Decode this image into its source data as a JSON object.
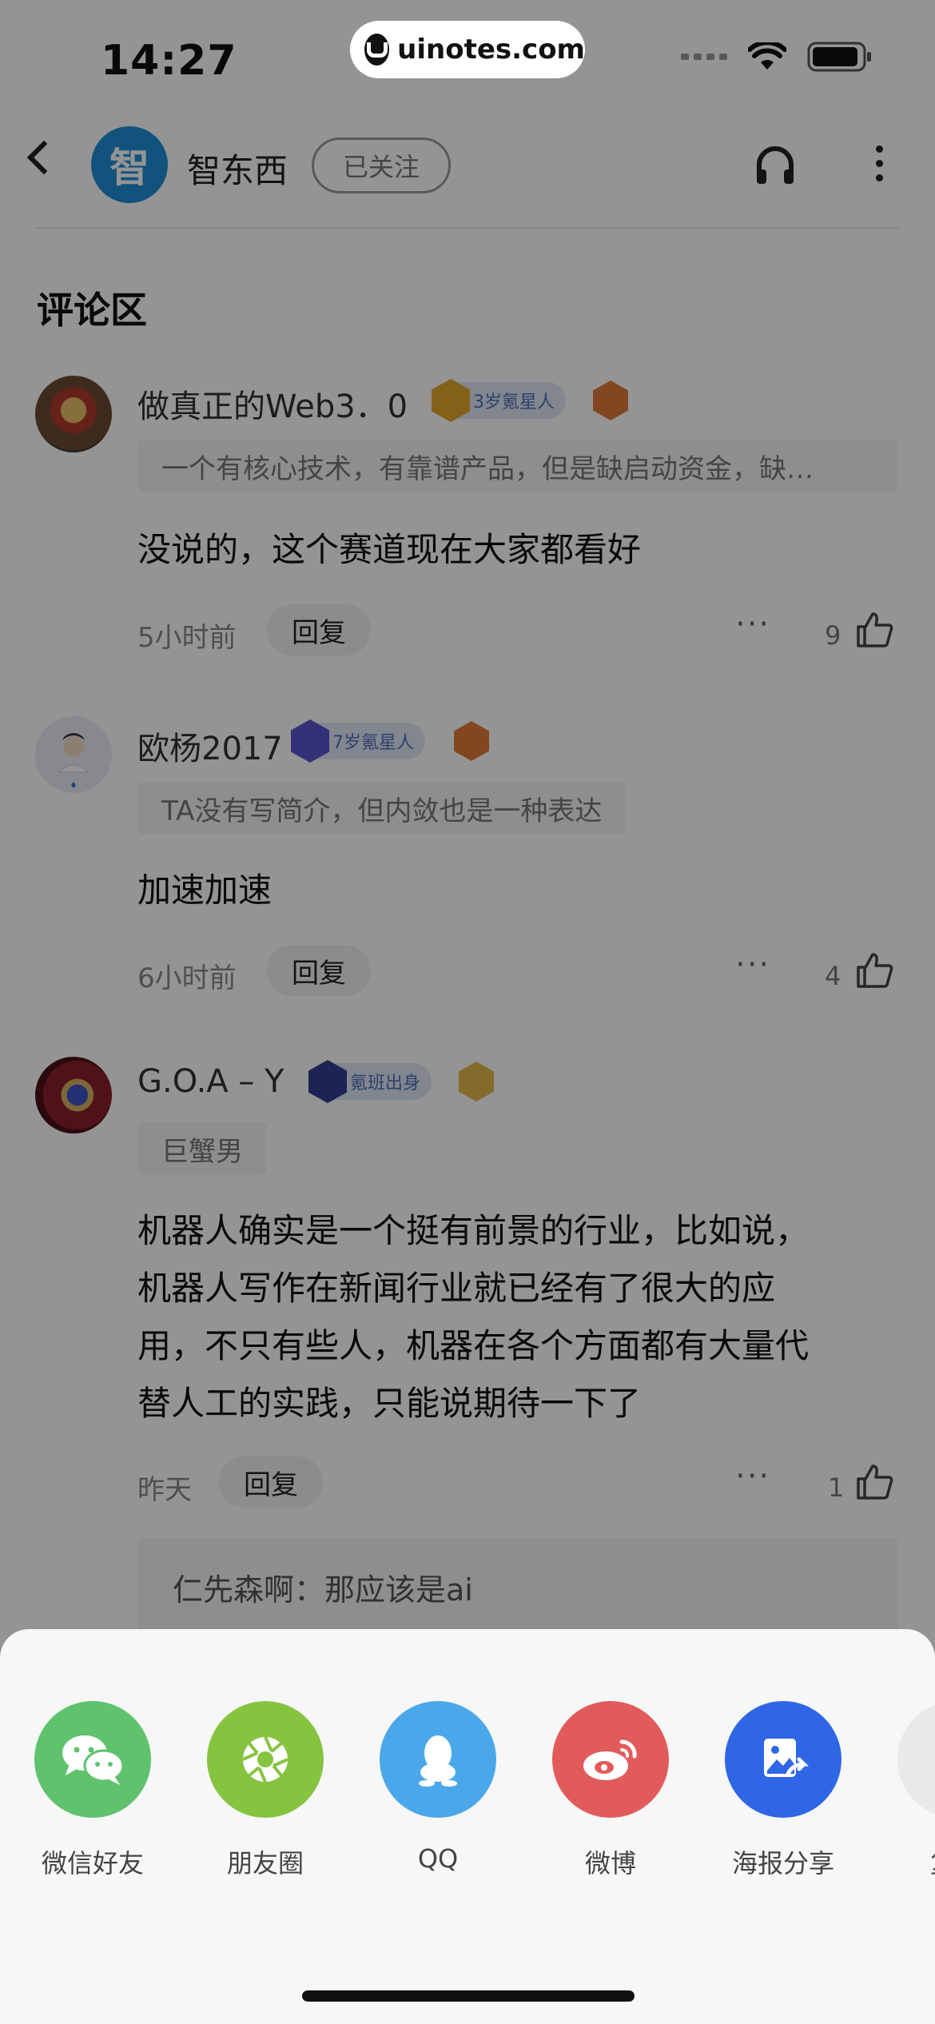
{
  "status_bar": {
    "time": "14:27",
    "watermark": "uinotes.com"
  },
  "header": {
    "account_name": "智东西",
    "follow_label": "已关注",
    "avatar_text": "智"
  },
  "section_title": "评论区",
  "comments": [
    {
      "user": "做真正的Web3．0",
      "badge": "3岁氪星人",
      "bio": "一个有核心技术，有靠谱产品，但是缺启动资金，缺…",
      "text": [
        "没说的，这个赛道现在大家都看好"
      ],
      "time": "5小时前",
      "reply_label": "回复",
      "likes": "9"
    },
    {
      "user": "欧杨2017",
      "badge": "7岁氪星人",
      "bio": "TA没有写简介，但内敛也是一种表达",
      "text": [
        "加速加速"
      ],
      "time": "6小时前",
      "reply_label": "回复",
      "likes": "4"
    },
    {
      "user": "G.O.A – Y",
      "badge": "氪班出身",
      "bio": "巨蟹男",
      "text": [
        "机器人确实是一个挺有前景的行业，比如说，",
        "机器人写作在新闻行业就已经有了很大的应",
        "用，不只有些人，机器在各个方面都有大量代",
        "替人工的实践，只能说期待一下了"
      ],
      "time": "昨天",
      "reply_label": "回复",
      "likes": "1",
      "sub_reply": "仁先森啊：那应该是ai"
    }
  ],
  "share_sheet": {
    "items": [
      {
        "label": "微信好友",
        "color": "#5ec36c",
        "icon": "wechat-icon"
      },
      {
        "label": "朋友圈",
        "color": "#86c440",
        "icon": "moments-icon"
      },
      {
        "label": "QQ",
        "color": "#4aa8ea",
        "icon": "qq-icon"
      },
      {
        "label": "微博",
        "color": "#e25b5b",
        "icon": "weibo-icon"
      },
      {
        "label": "海报分享",
        "color": "#2f66e6",
        "icon": "poster-icon"
      },
      {
        "label": "复制",
        "color": "#e9e9e9",
        "icon": "copy-icon"
      }
    ]
  }
}
